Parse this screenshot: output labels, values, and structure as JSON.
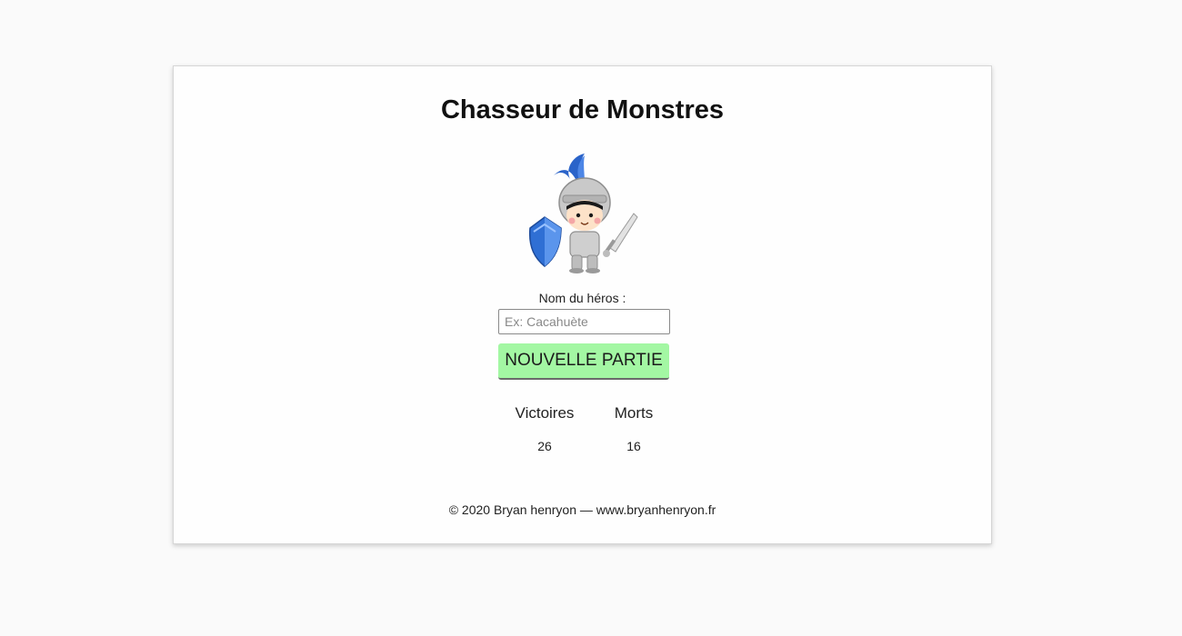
{
  "game": {
    "title": "Chasseur de Monstres",
    "hero_image": "knight-mascot-image",
    "name_label": "Nom du héros :",
    "name_placeholder": "Ex: Cacahuète",
    "name_value": "",
    "new_game_label": "NOUVELLE PARTIE",
    "button_color": "#a3f7a3"
  },
  "stats": {
    "victories_label": "Victoires",
    "victories_value": "26",
    "deaths_label": "Morts",
    "deaths_value": "16"
  },
  "footer": {
    "text": "© 2020 Bryan henryon — www.bryanhenryon.fr"
  }
}
